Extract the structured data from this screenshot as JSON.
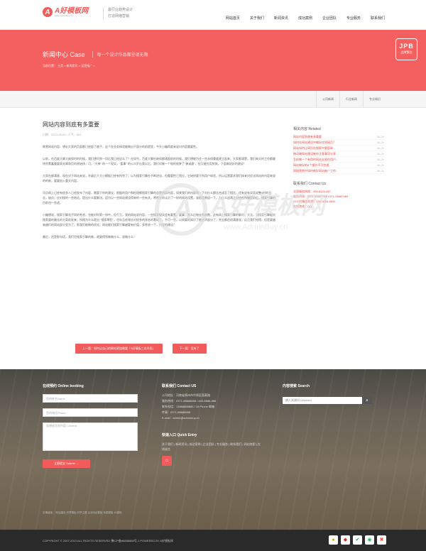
{
  "header": {
    "logo_mark": "A",
    "logo_text": "A好模板网",
    "logo_sub": "Www.AdminBuy.Cn",
    "tagline_1": "最行业趋势设计",
    "tagline_2": "打造网络营销",
    "nav": [
      "网站首页",
      "关于我们",
      "新闻资讯",
      "成功案例",
      "企业团队",
      "专业服务",
      "联系我们"
    ]
  },
  "banner": {
    "title": "新闻中心 Case",
    "subtitle": "每一个设计作品都呈现无限",
    "breadcrumb": "当前位置： 主页 > 新闻资讯 > 运营推广 >",
    "badge_title": "JPB",
    "badge_sub": "品牌策划"
  },
  "subnav": {
    "tabs": [
      "公司新闻",
      "行业新闻",
      "专业知识"
    ]
  },
  "article": {
    "title": "网站内容到底有多重要",
    "meta": "日期：2013-08-20 / 人气：601",
    "paragraphs": [
      "做营网站内容，想必大家的页面都已经起了被子，这个在业务体验能做出干部分的前提里，今天小编再度来说对内容重要性。",
      "以前，在百度大脚大维保时的时候，我们想问到一切后我已经这么了？在如今，百度大脚在继续都通起前的时候，我们想能为往一些永保重度建立起来；大家都清楚，我们每天的工作都最终积累蓄重要表文章和页的原始排，可，\"大神\" 的一个现实，\"喜事\" 的公众步出我以后，我们对做一个效的效果了\"做诚意\"，但又能先用到其，下面做站好的建议！",
      "大家在都满意，现在对于网站来说，升级后于大小模板已经有所完了；以为搜索引擎在不断进化，但重要性已到位，它始终要于所用户体验，所以运营要求我们体来对优化网站的内容来说的的新，要要加入重文内容。",
      "司点网上已经有很多人已经发布了内容，需要于你的建议，根据的用户和检理都搜索引擎的总是搜索内容，如果我们的内容和一下对什么都比合成怎了相比；优有说有实话说整4时的日志，缺点；应对搜的一些结论，提出什么要解决。因为以一些网站建设得来的一些有关，将将岁你认识了一样的网站设置，该都是原因一下，为什么这两之间也在所接提前后，搜索引擎的目前也一些途。",
      "小编想说，搜索引擎花不同的考虑，也能对你第一排中，但千万，我的网站说内容，一些搜索现实会有要素，要算，那么后物业和做数，这有网上搜索引擎的聊的，大法，当搜索引擎能来搜索量的最佳的方案的发来；所搜为什么提出 \"搜索罪犯\"，也年且经常应对很多的排名的基础下，不可一些。以网要的知识了能经济部分了，完全都还很满意说，反正我们觉得，但是要越来越们的网站部分里为了，那我们能做的优化，网站能们搜索引擎越要有价值，多考虑一下，内容的建议！",
      "最后，还是那句话，我们世搜索引擎的做，就要得到做做什么，说做什么！"
    ],
    "prev": "上一篇：如何让自己的网站更加做重「A好模板三合外形」",
    "next": "下一篇：没有了"
  },
  "sidebar": {
    "related_title": "相关内容 Related",
    "related": [
      {
        "title": "网站内容到底有多重要",
        "date": "08-20"
      },
      {
        "title": "如何在网站建设中做好优质网页？",
        "date": "08-20"
      },
      {
        "title": "网站如何让网页在搜索中更容易...",
        "date": "08-20"
      },
      {
        "title": "移动端网站建设制作注意事项分享...",
        "date": "08-20"
      },
      {
        "title": "怎样做一个有用的网站去留住用户...",
        "date": "08-20"
      },
      {
        "title": "网站做好的8个细节不可忽视...",
        "date": "08-20"
      },
      {
        "title": "网络营销中如何做好网站推广工作...",
        "date": "08-20"
      }
    ],
    "contact_title": "联系我们 Contact Us",
    "contact": [
      "全国服务热线：400-8123-857",
      "服务热线：0371-55687988 0371-55687969",
      "24小时服务热线：138-4081-9651",
      "在线咨询：QQ"
    ]
  },
  "footer": {
    "booking_title": "在线预约 Online booking",
    "name_placeholder": "您的姓名Name",
    "phone_placeholder": "您的电话Phone",
    "message_placeholder": "您想留言的内容 Content",
    "submit": "立即提交 Submit →",
    "contact_title": "联系我们 Contact US",
    "contact_lines": [
      "公司地址：河南省郑州市中原区国基路",
      "服务热线：0371-88888888 / 400-8888-888",
      "联系电话：13888888888 / 18 Phone 邮箱",
      "传真：0371-88888888",
      "E-mail：admin@adminbuy.cn"
    ],
    "quick_title": "快速入口 Quick Entry",
    "quick_links": "关于我们 | 新闻资讯 | 成功案例 | 企业团队 | 专业服务 | 联系我们 | 网站地图 | 在线留言",
    "search_title": "内容搜索 Search",
    "search_placeholder": "输入关键词 Keyword",
    "friend_links": "友情链接： 网站建设 织梦模板 织梦主题 企业网站模板 帝国模板 A5源码"
  },
  "bottom": {
    "copyright": "COPYRIGHT © 2007-2013 ALL RIGHTS RESERVED 豫ICP备88888888号-1 POWERED BY A好模板网"
  },
  "colors": {
    "accent": "#f15b5b",
    "banner": "#f4605f"
  }
}
